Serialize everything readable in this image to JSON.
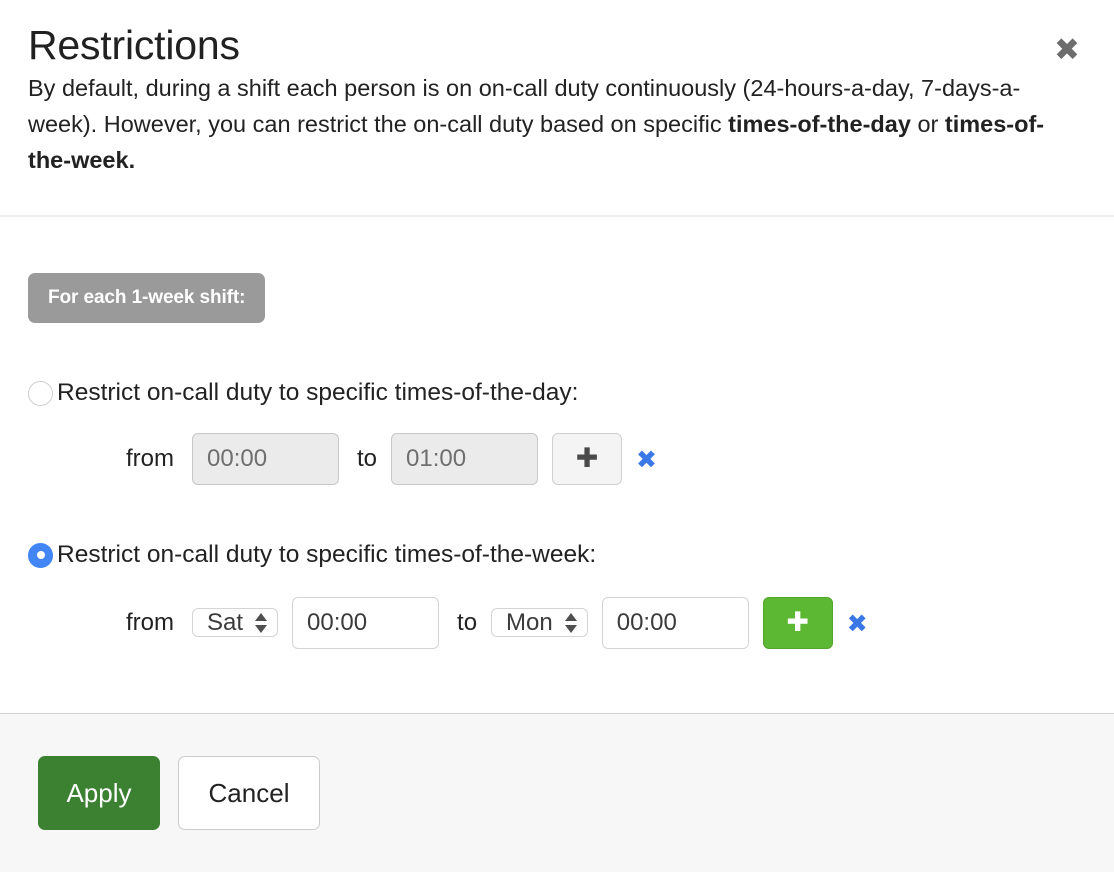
{
  "dialog": {
    "title": "Restrictions",
    "description_prefix": "By default, during a shift each person is on on-call duty continuously (24-hours-a-day, 7-days-a-week). However, you can restrict the on-call duty based on specific ",
    "description_bold_1": "times-of-the-day",
    "description_middle": " or ",
    "description_bold_2": "times-of-the-week.",
    "close_icon": "close-icon",
    "close_glyph": "✖"
  },
  "body": {
    "shift_badge": "For each 1-week shift:",
    "day_option": {
      "label": "Restrict on-call duty to specific times-of-the-day:",
      "selected": false,
      "from_label": "from",
      "from_value": "00:00",
      "to_label": "to",
      "to_value": "01:00",
      "add_glyph": "✚",
      "remove_glyph": "✖"
    },
    "week_option": {
      "label": "Restrict on-call duty to specific times-of-the-week:",
      "selected": true,
      "from_label": "from",
      "from_day": "Sat",
      "from_time": "00:00",
      "to_label": "to",
      "to_day": "Mon",
      "to_time": "00:00",
      "add_glyph": "✚",
      "remove_glyph": "✖"
    }
  },
  "footer": {
    "apply_label": "Apply",
    "cancel_label": "Cancel"
  },
  "colors": {
    "accent_blue": "#3b78e7",
    "radio_blue": "#4285f4",
    "add_green": "#5cb832",
    "apply_green": "#3c8132",
    "badge_gray": "#9a9a9a",
    "footer_bg": "#f7f7f7"
  }
}
